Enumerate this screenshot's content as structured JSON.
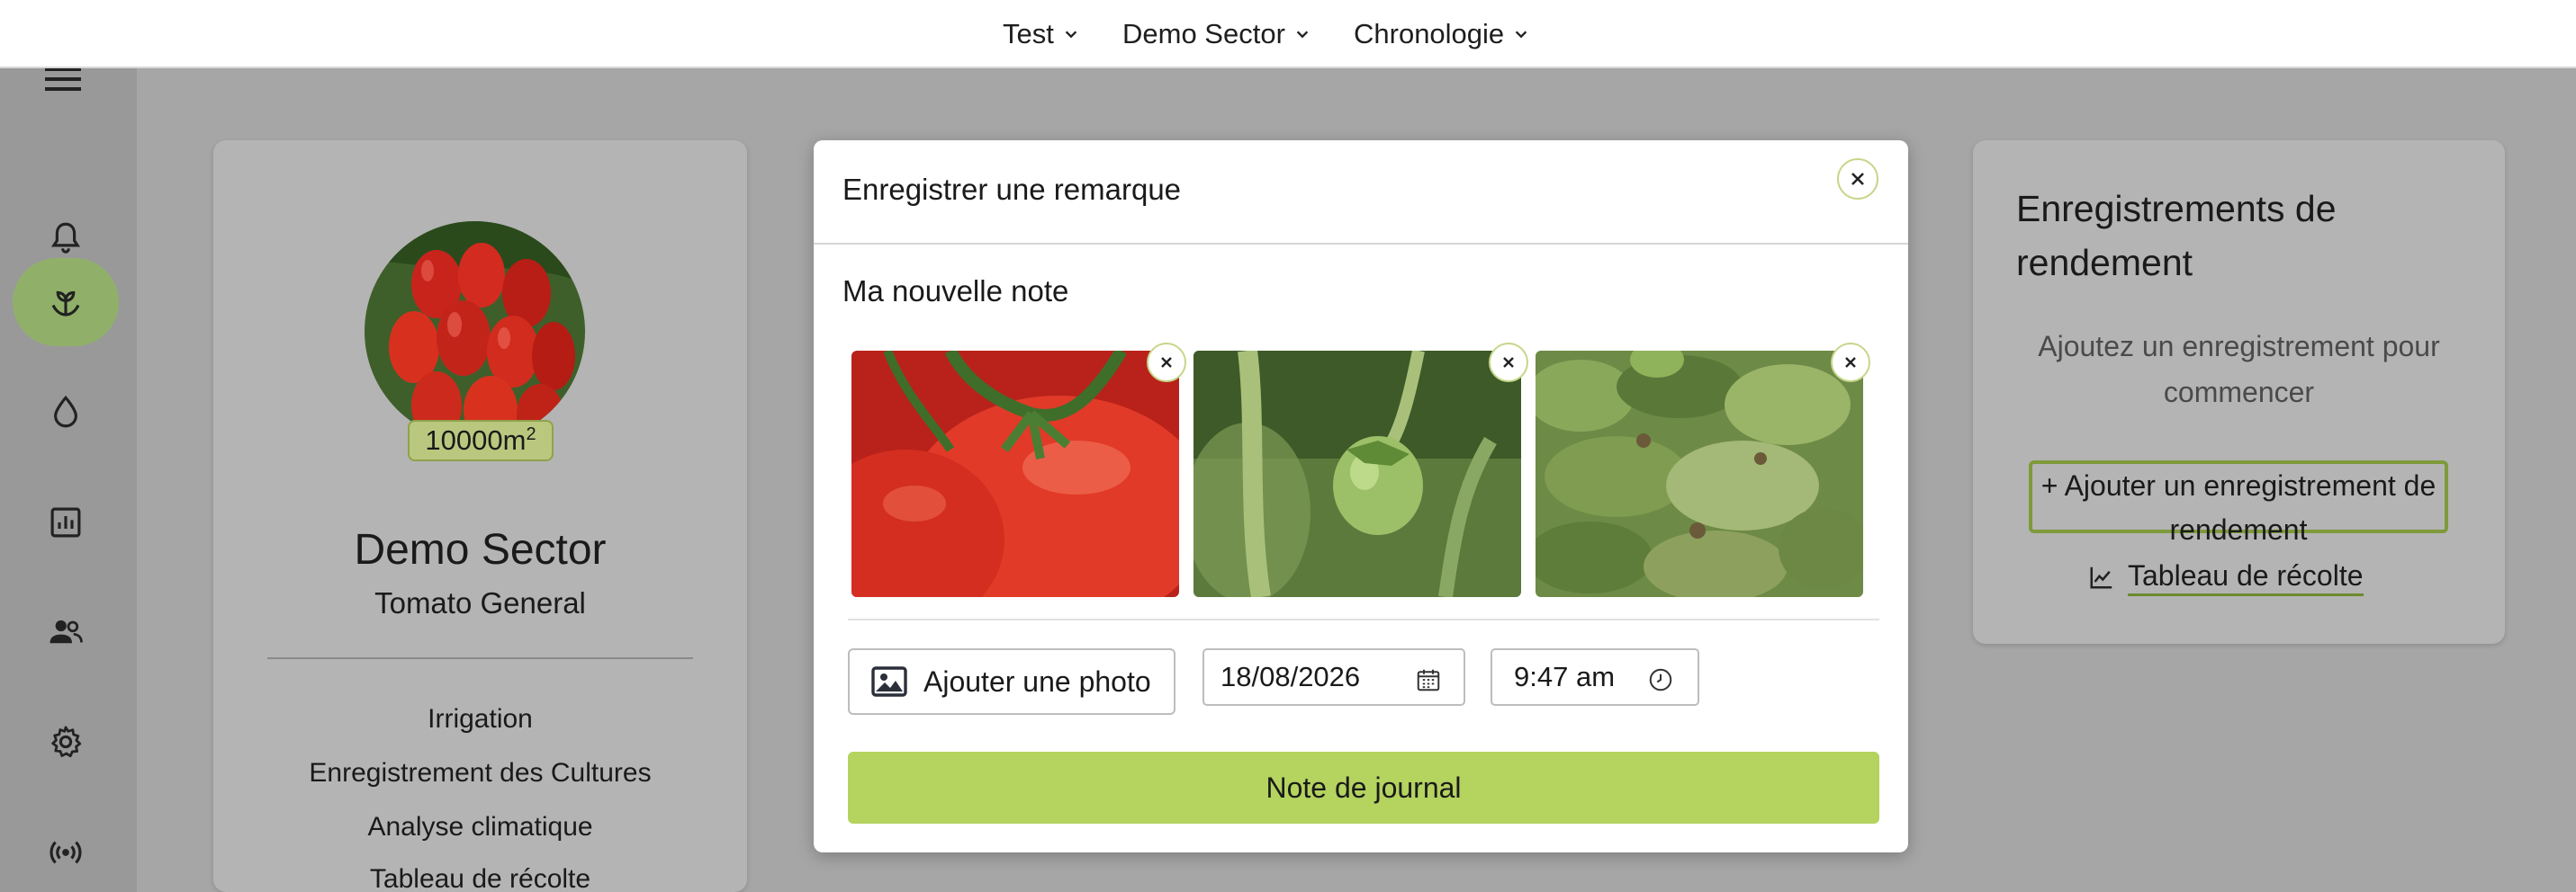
{
  "topbar": {
    "menus": [
      {
        "label": "Test"
      },
      {
        "label": "Demo Sector"
      },
      {
        "label": "Chronologie"
      }
    ]
  },
  "sidebar": {
    "items": [
      {
        "icon": "bell-icon"
      },
      {
        "icon": "sprout-icon",
        "active": true
      },
      {
        "icon": "water-drop-icon"
      },
      {
        "icon": "bar-chart-icon"
      },
      {
        "icon": "users-icon"
      },
      {
        "icon": "gear-icon"
      },
      {
        "icon": "broadcast-icon"
      }
    ],
    "active_color": "#90b06a"
  },
  "sector_card": {
    "area_value": "10000m",
    "area_exponent": "2",
    "name": "Demo Sector",
    "crop": "Tomato General",
    "links": [
      "Irrigation",
      "Enregistrement des Cultures",
      "Analyse climatique",
      "Tableau de récolte"
    ]
  },
  "yield_card": {
    "title": "Enregistrements de rendement",
    "empty_text": "Ajoutez un enregistrement pour commencer",
    "add_button": "+ Ajouter un enregistrement de rendement",
    "chart_link": "Tableau de récolte"
  },
  "modal": {
    "title": "Enregistrer une remarque",
    "note_value": "Ma nouvelle note",
    "photos": [
      {
        "subject": "red-tomatoes-photo"
      },
      {
        "subject": "green-tomato-photo"
      },
      {
        "subject": "diseased-plant-photo"
      }
    ],
    "add_photo_label": "Ajouter une photo",
    "date_value": "18/08/2026",
    "time_value": "9:47 am",
    "submit_label": "Note de journal"
  },
  "colors": {
    "accent": "#b4d35f",
    "overlay": "#a6a6a6",
    "border_accent": "#c7d68a"
  }
}
